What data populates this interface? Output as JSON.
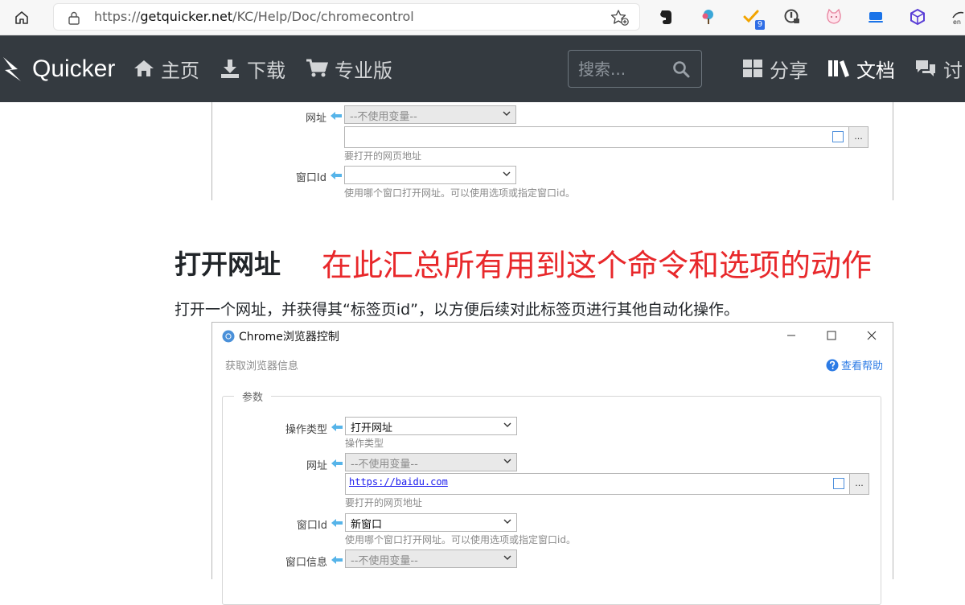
{
  "browser": {
    "url_prefix": "https://",
    "url_host": "getquicker.net",
    "url_path": "/KC/Help/Doc/chromecontrol",
    "extension_badge": "9"
  },
  "nav": {
    "brand": "Quicker",
    "links": [
      {
        "label": "主页"
      },
      {
        "label": "下载"
      },
      {
        "label": "专业版"
      },
      {
        "label": "分享"
      },
      {
        "label": "文档"
      },
      {
        "label": "讨"
      }
    ],
    "search_placeholder": "搜索..."
  },
  "top_shot": {
    "url_label": "网址",
    "url_combo": "--不使用变量--",
    "url_hint": "要打开的网页地址",
    "window_label": "窗口Id",
    "window_combo": "",
    "window_hint": "使用哪个窗口打开网址。可以使用选项或指定窗口id。",
    "more_btn": "..."
  },
  "section": {
    "title": "打开网址",
    "annotation": "在此汇总所有用到这个命令和选项的动作",
    "paragraph": "打开一个网址，并获得其“标签页id”，以方便后续对此标签页进行其他自动化操作。"
  },
  "dialog": {
    "title": "Chrome浏览器控制",
    "subtitle": "获取浏览器信息",
    "help_link": "查看帮助",
    "group_label": "参数",
    "fields": {
      "action_type_label": "操作类型",
      "action_type_value": "打开网址",
      "action_type_hint": "操作类型",
      "url_label": "网址",
      "url_combo": "--不使用变量--",
      "url_value": "https://baidu.com",
      "url_hint": "要打开的网页地址",
      "window_label": "窗口Id",
      "window_value": "新窗口",
      "window_hint": "使用哪个窗口打开网址。可以使用选项或指定窗口id。",
      "window_info_label": "窗口信息",
      "window_info_combo": "--不使用变量--",
      "more_btn": "..."
    }
  },
  "colors": {
    "nav_bg": "#343a40",
    "annotation": "#e8282b",
    "link": "#2c7be5",
    "arrow": "#56b4e9"
  }
}
